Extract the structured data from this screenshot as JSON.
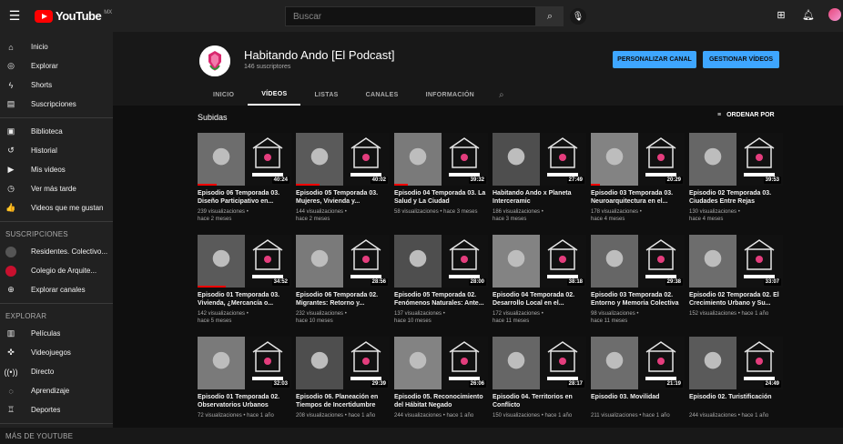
{
  "header": {
    "logo_text": "YouTube",
    "logo_region": "MX",
    "search_placeholder": "Buscar"
  },
  "sidebar": {
    "main": [
      {
        "label": "Inicio",
        "icon": "home-icon",
        "glyph": "⌂"
      },
      {
        "label": "Explorar",
        "icon": "compass-icon",
        "glyph": "◎"
      },
      {
        "label": "Shorts",
        "icon": "shorts-icon",
        "glyph": "ϟ"
      },
      {
        "label": "Suscripciones",
        "icon": "subscriptions-icon",
        "glyph": "▤"
      }
    ],
    "library": [
      {
        "label": "Biblioteca",
        "icon": "library-icon",
        "glyph": "▣"
      },
      {
        "label": "Historial",
        "icon": "history-icon",
        "glyph": "↺"
      },
      {
        "label": "Mis videos",
        "icon": "my-videos-icon",
        "glyph": "▶"
      },
      {
        "label": "Ver más tarde",
        "icon": "watch-later-icon",
        "glyph": "◷"
      },
      {
        "label": "Videos que me gustan",
        "icon": "like-icon",
        "glyph": "👍"
      }
    ],
    "subs_heading": "SUSCRIPCIONES",
    "subs": [
      {
        "label": "Residentes. Colectivo...",
        "color": "#555555"
      },
      {
        "label": "Colegio de Arquite...",
        "color": "#c8102e"
      },
      {
        "label": "Explorar canales",
        "color": ""
      }
    ],
    "explore_heading": "EXPLORAR",
    "explore": [
      {
        "label": "Películas",
        "icon": "film-icon",
        "glyph": "▥"
      },
      {
        "label": "Videojuegos",
        "icon": "gamepad-icon",
        "glyph": "✜"
      },
      {
        "label": "Directo",
        "icon": "live-icon",
        "glyph": "((•))"
      },
      {
        "label": "Aprendizaje",
        "icon": "bulb-icon",
        "glyph": "◌"
      },
      {
        "label": "Deportes",
        "icon": "trophy-icon",
        "glyph": "♖"
      }
    ],
    "more_heading": "MÁS DE YOUTUBE"
  },
  "channel": {
    "name": "Habitando Ando [El Podcast]",
    "subscribers": "146 suscriptores",
    "customize_button": "PERSONALIZAR CANAL",
    "manage_button": "GESTIONAR VÍDEOS",
    "tabs": [
      "INICIO",
      "VÍDEOS",
      "LISTAS",
      "CANALES",
      "INFORMACIÓN"
    ],
    "active_tab": 1
  },
  "section": {
    "title": "Subidas",
    "sort_label": "ORDENAR POR"
  },
  "videos": [
    [
      {
        "title": "Episodio 06 Temporada 03. Diseño Participativo en...",
        "meta1": "239 visualizaciones •",
        "meta2": "hace 2 meses",
        "duration": "40:24",
        "progress": 0.2
      },
      {
        "title": "Episodio 05 Temporada 03. Mujeres, Vivienda y...",
        "meta1": "144 visualizaciones •",
        "meta2": "hace 2 meses",
        "duration": "40:02",
        "progress": 0.25
      },
      {
        "title": "Episodio 04 Temporada 03. La Salud y La Ciudad",
        "meta1": "58 visualizaciones • hace 3 meses",
        "meta2": "",
        "duration": "39:32",
        "progress": 0.15
      },
      {
        "title": "Habitando Ando x Planeta Interceramic",
        "meta1": "186 visualizaciones •",
        "meta2": "hace 3 meses",
        "duration": "27:49",
        "progress": 0
      },
      {
        "title": "Episodio 03 Temporada 03. Neuroarquitectura en el...",
        "meta1": "178 visualizaciones •",
        "meta2": "hace 4 meses",
        "duration": "20:29",
        "progress": 0.1
      },
      {
        "title": "Episodio 02 Temporada 03. Ciudades Entre Rejas",
        "meta1": "130 visualizaciones •",
        "meta2": "hace 4 meses",
        "duration": "39:53",
        "progress": 0
      }
    ],
    [
      {
        "title": "Episodio 01 Temporada 03. Vivienda, ¿Mercancía o...",
        "meta1": "142 visualizaciones •",
        "meta2": "hace 5 meses",
        "duration": "34:52",
        "progress": 0.3
      },
      {
        "title": "Episodio 06 Temporada 02. Migrantes: Retorno y...",
        "meta1": "232 visualizaciones •",
        "meta2": "hace 10 meses",
        "duration": "28:56",
        "progress": 0
      },
      {
        "title": "Episodio 05 Temporada 02. Fenómenos Naturales: Ante...",
        "meta1": "137 visualizaciones •",
        "meta2": "hace 10 meses",
        "duration": "28:00",
        "progress": 0
      },
      {
        "title": "Episodio 04 Temporada 02. Desarrollo Local en el...",
        "meta1": "172 visualizaciones •",
        "meta2": "hace 11 meses",
        "duration": "38:18",
        "progress": 0
      },
      {
        "title": "Episodio 03 Temporada 02. Entorno y Memoria Colectiva",
        "meta1": "98 visualizaciones •",
        "meta2": "hace 11 meses",
        "duration": "29:38",
        "progress": 0
      },
      {
        "title": "Episodio 02 Temporada 02. El Crecimiento Urbano y Su...",
        "meta1": "152 visualizaciones • hace 1 año",
        "meta2": "",
        "duration": "33:07",
        "progress": 0
      }
    ],
    [
      {
        "title": "Episodio 01 Temporada 02. Observatorios Urbanos",
        "meta1": "72 visualizaciones • hace 1 año",
        "meta2": "",
        "duration": "32:03",
        "progress": 0
      },
      {
        "title": "Episodio 06. Planeación en Tiempos de Incertidumbre",
        "meta1": "208 visualizaciones • hace 1 año",
        "meta2": "",
        "duration": "29:39",
        "progress": 0
      },
      {
        "title": "Episodio 05. Reconocimiento del Hábitat Negado",
        "meta1": "244 visualizaciones • hace 1 año",
        "meta2": "",
        "duration": "26:06",
        "progress": 0
      },
      {
        "title": "Episodio 04. Territorios en Conflicto",
        "meta1": "150 visualizaciones • hace 1 año",
        "meta2": "",
        "duration": "28:17",
        "progress": 0
      },
      {
        "title": "Episodio 03. Movilidad",
        "meta1": "211 visualizaciones • hace 1 año",
        "meta2": "",
        "duration": "21:19",
        "progress": 0
      },
      {
        "title": "Episodio 02. Turistificación",
        "meta1": "244 visualizaciones • hace 1 año",
        "meta2": "",
        "duration": "24:49",
        "progress": 0
      }
    ]
  ]
}
